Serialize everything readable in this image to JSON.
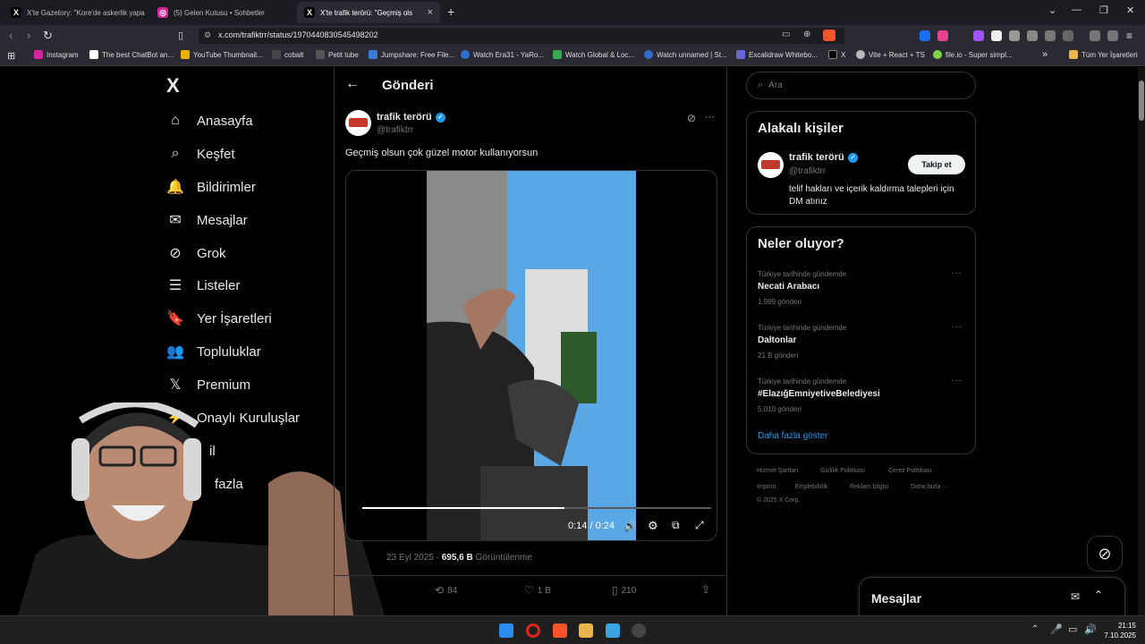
{
  "browser": {
    "tabs": [
      {
        "title": "X'te Gazetory: \"Kore'de askerlik yapa",
        "icon": "x-icon"
      },
      {
        "title": "(5) Gelen Kutusu • Sohbetler",
        "icon": "instagram-icon"
      },
      {
        "title": "X'te trafik terörü: \"Geçmiş ols",
        "icon": "x-icon"
      }
    ],
    "new_tab": "+",
    "url": "x.com/trafiktrr/status/1970440830545498202",
    "bookmarks": [
      {
        "label": "Instagram",
        "color": "#d6249f"
      },
      {
        "label": "The best ChatBot an...",
        "color": "#ffffff"
      },
      {
        "label": "YouTube Thumbnail...",
        "color": "#e9b200"
      },
      {
        "label": "cobalt",
        "color": "#ffffff"
      },
      {
        "label": "Petit tube",
        "color": "#ffffff"
      },
      {
        "label": "Jumpshare: Free File...",
        "color": "#3a7bd5"
      },
      {
        "label": "Watch Era31 - YaRo...",
        "color": "#2f6fd1"
      },
      {
        "label": "Watch Global & Loc...",
        "color": "#34a853"
      },
      {
        "label": "Watch unnamed | St...",
        "color": "#2f6fd1"
      },
      {
        "label": "Excalidraw Whitebo...",
        "color": "#6965db"
      },
      {
        "label": "X",
        "color": "#ffffff"
      },
      {
        "label": "Vite + React + TS",
        "color": "#bbbbbb"
      },
      {
        "label": "file.io - Super simpl...",
        "color": "#7bd44a"
      }
    ],
    "bookmarks_more": "»",
    "all_bookmarks": "Tüm Yer İşaretleri"
  },
  "nav": {
    "items": [
      {
        "label": "Anasayfa",
        "icon": "home-icon",
        "glyph": "⌂"
      },
      {
        "label": "Keşfet",
        "icon": "search-icon",
        "glyph": "⌕"
      },
      {
        "label": "Bildirimler",
        "icon": "bell-icon",
        "glyph": "🔔"
      },
      {
        "label": "Mesajlar",
        "icon": "mail-icon",
        "glyph": "✉"
      },
      {
        "label": "Grok",
        "icon": "grok-icon",
        "glyph": "⊘"
      },
      {
        "label": "Listeler",
        "icon": "list-icon",
        "glyph": "☰"
      },
      {
        "label": "Yer İşaretleri",
        "icon": "bookmark-icon",
        "glyph": "🔖"
      },
      {
        "label": "Topluluklar",
        "icon": "communities-icon",
        "glyph": "👥"
      },
      {
        "label": "Premium",
        "icon": "x-icon",
        "glyph": "𝕏"
      },
      {
        "label": "Onaylı Kuruluşlar",
        "icon": "lightning-icon",
        "glyph": "⚡"
      },
      {
        "label": "il",
        "icon": "profile-icon",
        "glyph": ""
      },
      {
        "label": "fazla",
        "icon": "more-icon",
        "glyph": ""
      }
    ]
  },
  "post": {
    "header_title": "Gönderi",
    "author_name": "trafik terörü",
    "author_handle": "@trafiktrr",
    "text": "Geçmiş olsun çok güzel motor kullanıyorsun",
    "video_time": "0:14 / 0:24",
    "video_progress": 0.58,
    "date": "23 Eyl 2025 ·",
    "views_count": "695,6 B",
    "views_label": "Görüntülenme",
    "retweets": "84",
    "likes": "1 B",
    "bookmarks": "210"
  },
  "sidebar": {
    "search_placeholder": "Ara",
    "related_title": "Alakalı kişiler",
    "related_name": "trafik terörü",
    "related_handle": "@trafiktrr",
    "follow_label": "Takip et",
    "related_bio": "telif hakları ve içerik kaldırma talepleri için DM atınız",
    "trends_title": "Neler oluyor?",
    "trends": [
      {
        "category": "Türkiye tarihinde gündemde",
        "name": "Necati Arabacı",
        "count": "1.999 gönderi"
      },
      {
        "category": "Türkiye tarihinde gündemde",
        "name": "Daltonlar",
        "count": "21 B gönderi"
      },
      {
        "category": "Türkiye tarihinde gündemde",
        "name": "#ElazığEmniyetiveBelediyesi",
        "count": "5.010 gönderi"
      }
    ],
    "show_more": "Daha fazla göster",
    "footer_links": [
      "Hizmet Şartları",
      "Gizlilik Politikası",
      "Çerez Politikası",
      "Imprint",
      "Erişilebilirlik",
      "Reklam bilgisi",
      "Daha fazla ···"
    ],
    "copyright": "© 2025 X Corp."
  },
  "messages_dock": {
    "title": "Mesajlar"
  },
  "taskbar": {
    "time": "21:15",
    "date": "7.10.2025"
  },
  "colors": {
    "accent": "#1d9bf0",
    "link": "#1d9bf0",
    "bg": "#000000",
    "border": "#2f3336"
  }
}
